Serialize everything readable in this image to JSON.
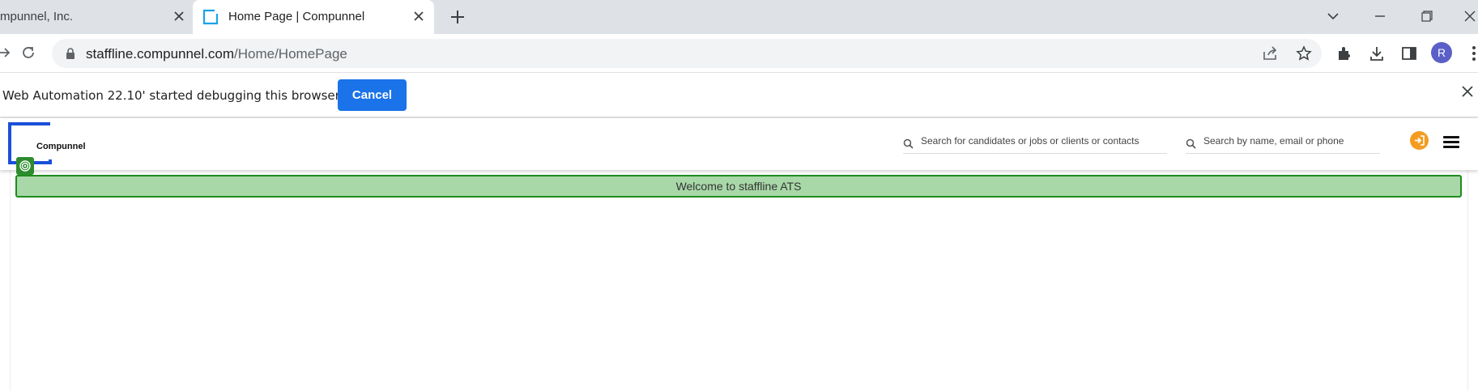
{
  "browser": {
    "tabs": [
      {
        "title": "mpunnel, Inc.",
        "active": false
      },
      {
        "title": "Home Page | Compunnel",
        "active": true
      }
    ],
    "url_host": "staffline.compunnel.com",
    "url_path": "/Home/HomePage",
    "avatar_letter": "R"
  },
  "infobar": {
    "message": "Web Automation 22.10' started debugging this browser",
    "cancel_label": "Cancel"
  },
  "app": {
    "logo_text": "Compunnel",
    "search_main_placeholder": "Search for candidates or jobs or clients or contacts",
    "search_people_placeholder": "Search by name, email or phone",
    "welcome_text": "Welcome to staffline ATS"
  },
  "colors": {
    "accent_blue": "#1a73e8",
    "welcome_bg": "#a8d8a8",
    "welcome_border": "#1e8c1e",
    "login_orange": "#f39c21",
    "logo_blue": "#1a4fd8"
  }
}
